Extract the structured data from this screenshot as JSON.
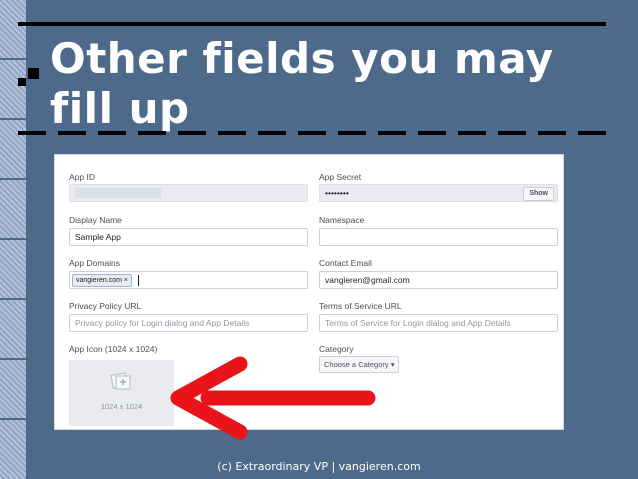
{
  "slide": {
    "title": "Other fields you may fill up",
    "footer": "(c) Extraordinary VP | vangieren.com"
  },
  "form": {
    "app_id": {
      "label": "App ID",
      "value": ""
    },
    "app_secret": {
      "label": "App Secret",
      "value": "••••••••",
      "show_label": "Show"
    },
    "display_name": {
      "label": "Display Name",
      "value": "Sample App"
    },
    "namespace": {
      "label": "Namespace",
      "value": ""
    },
    "app_domains": {
      "label": "App Domains",
      "token": "vangieren.com ×"
    },
    "contact_email": {
      "label": "Contact Email",
      "value": "vangieren@gmail.com"
    },
    "privacy_policy": {
      "label": "Privacy Policy URL",
      "placeholder": "Privacy policy for Login dialog and App Details"
    },
    "terms_of_service": {
      "label": "Terms of Service URL",
      "placeholder": "Terms of Service for Login dialog and App Details"
    },
    "app_icon": {
      "label": "App Icon (1024 x 1024)",
      "size_text": "1024 x 1024"
    },
    "category": {
      "label": "Category",
      "button": "Choose a Category ▾"
    }
  },
  "colors": {
    "background": "#4e6a8b",
    "arrow": "#e8141a",
    "title_text": "#ffffff"
  }
}
